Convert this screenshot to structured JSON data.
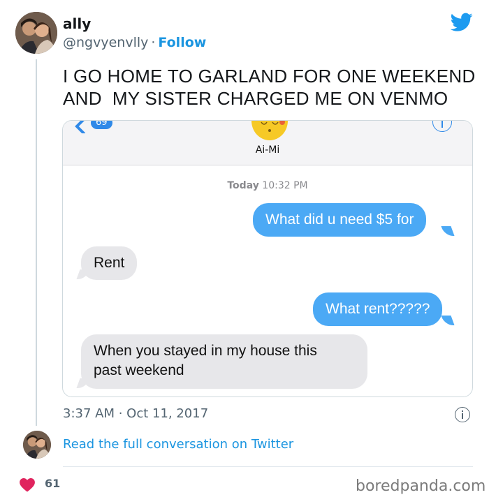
{
  "tweet": {
    "display_name": "ally",
    "handle": "@ngvyenvlly",
    "separator": "·",
    "follow_label": "Follow",
    "text_line1": "I GO HOME TO GARLAND FOR ONE WEEKEND",
    "text_line2": "AND  MY SISTER CHARGED ME ON VENMO",
    "date": "3:37 AM · Oct 11, 2017",
    "read_link": "Read the full conversation on Twitter",
    "like_count": "61"
  },
  "screenshot": {
    "back_badge": "69",
    "contact_name": "Ai-Mi",
    "timestamp_day": "Today",
    "timestamp_time": "10:32 PM",
    "messages": [
      {
        "from": "me",
        "text": "What did u need $5 for"
      },
      {
        "from": "them",
        "text": "Rent"
      },
      {
        "from": "me",
        "text": "What rent?????"
      },
      {
        "from": "them",
        "text_line1": "When you stayed in my house this",
        "text_line2": "past weekend"
      }
    ]
  },
  "watermark": "boredpanda.com",
  "colors": {
    "link_blue": "#1b95e0",
    "imessage_blue": "#4ba9f5",
    "imessage_gray": "#e7e7ea",
    "heart_red": "#e0245e"
  },
  "icons": [
    "twitter-bird-icon",
    "info-icon",
    "heart-icon",
    "back-chevron-icon",
    "emoji-face-icon"
  ]
}
